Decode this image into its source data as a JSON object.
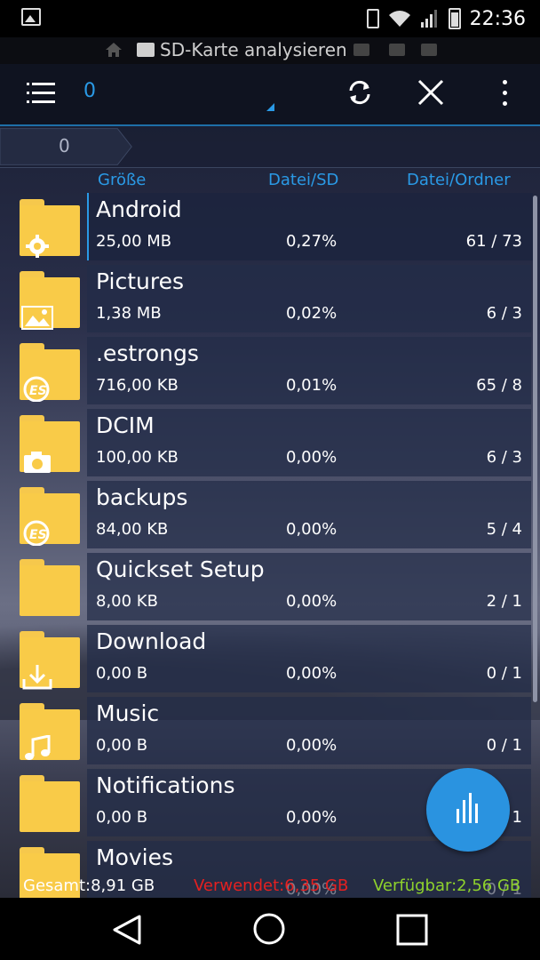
{
  "statusbar": {
    "time": "22:36"
  },
  "ticker": {
    "text": "SD-Karte analysieren"
  },
  "toolbar": {
    "tab_label": "0"
  },
  "breadcrumb": {
    "label": "0"
  },
  "columns": {
    "size": "Größe",
    "file_sd": "Datei/SD",
    "file_folder": "Datei/Ordner"
  },
  "rows": [
    {
      "name": "Android",
      "size": "25,00 MB",
      "pct": "0,27%",
      "count": "61 / 73",
      "overlay": "gear-icon"
    },
    {
      "name": "Pictures",
      "size": "1,38 MB",
      "pct": "0,02%",
      "count": "6 / 3",
      "overlay": "image-icon"
    },
    {
      "name": ".estrongs",
      "size": "716,00 KB",
      "pct": "0,01%",
      "count": "65 / 8",
      "overlay": "es-logo-icon"
    },
    {
      "name": "DCIM",
      "size": "100,00 KB",
      "pct": "0,00%",
      "count": "6 / 3",
      "overlay": "camera-icon"
    },
    {
      "name": "backups",
      "size": "84,00 KB",
      "pct": "0,00%",
      "count": "5 / 4",
      "overlay": "es-logo-icon"
    },
    {
      "name": "Quickset Setup",
      "size": "8,00 KB",
      "pct": "0,00%",
      "count": "2 / 1",
      "overlay": ""
    },
    {
      "name": "Download",
      "size": "0,00 B",
      "pct": "0,00%",
      "count": "0 / 1",
      "overlay": "download-icon"
    },
    {
      "name": "Music",
      "size": "0,00 B",
      "pct": "0,00%",
      "count": "0 / 1",
      "overlay": "music-note-icon"
    },
    {
      "name": "Notifications",
      "size": "0,00 B",
      "pct": "0,00%",
      "count": "0 / 1",
      "overlay": ""
    },
    {
      "name": "Movies",
      "size": "",
      "pct": "0,00%",
      "count": "0 / 1",
      "overlay": ""
    }
  ],
  "stats": {
    "total": "Gesamt:8,91 GB",
    "used": "Verwendet:6,35 GB",
    "free": "Verfügbar:2,56 GB",
    "colors": {
      "total": "#ffffff",
      "used": "#e52020",
      "free": "#8fd22c"
    }
  },
  "colors": {
    "accent": "#2a9ae6",
    "folder": "#f9cb48"
  }
}
